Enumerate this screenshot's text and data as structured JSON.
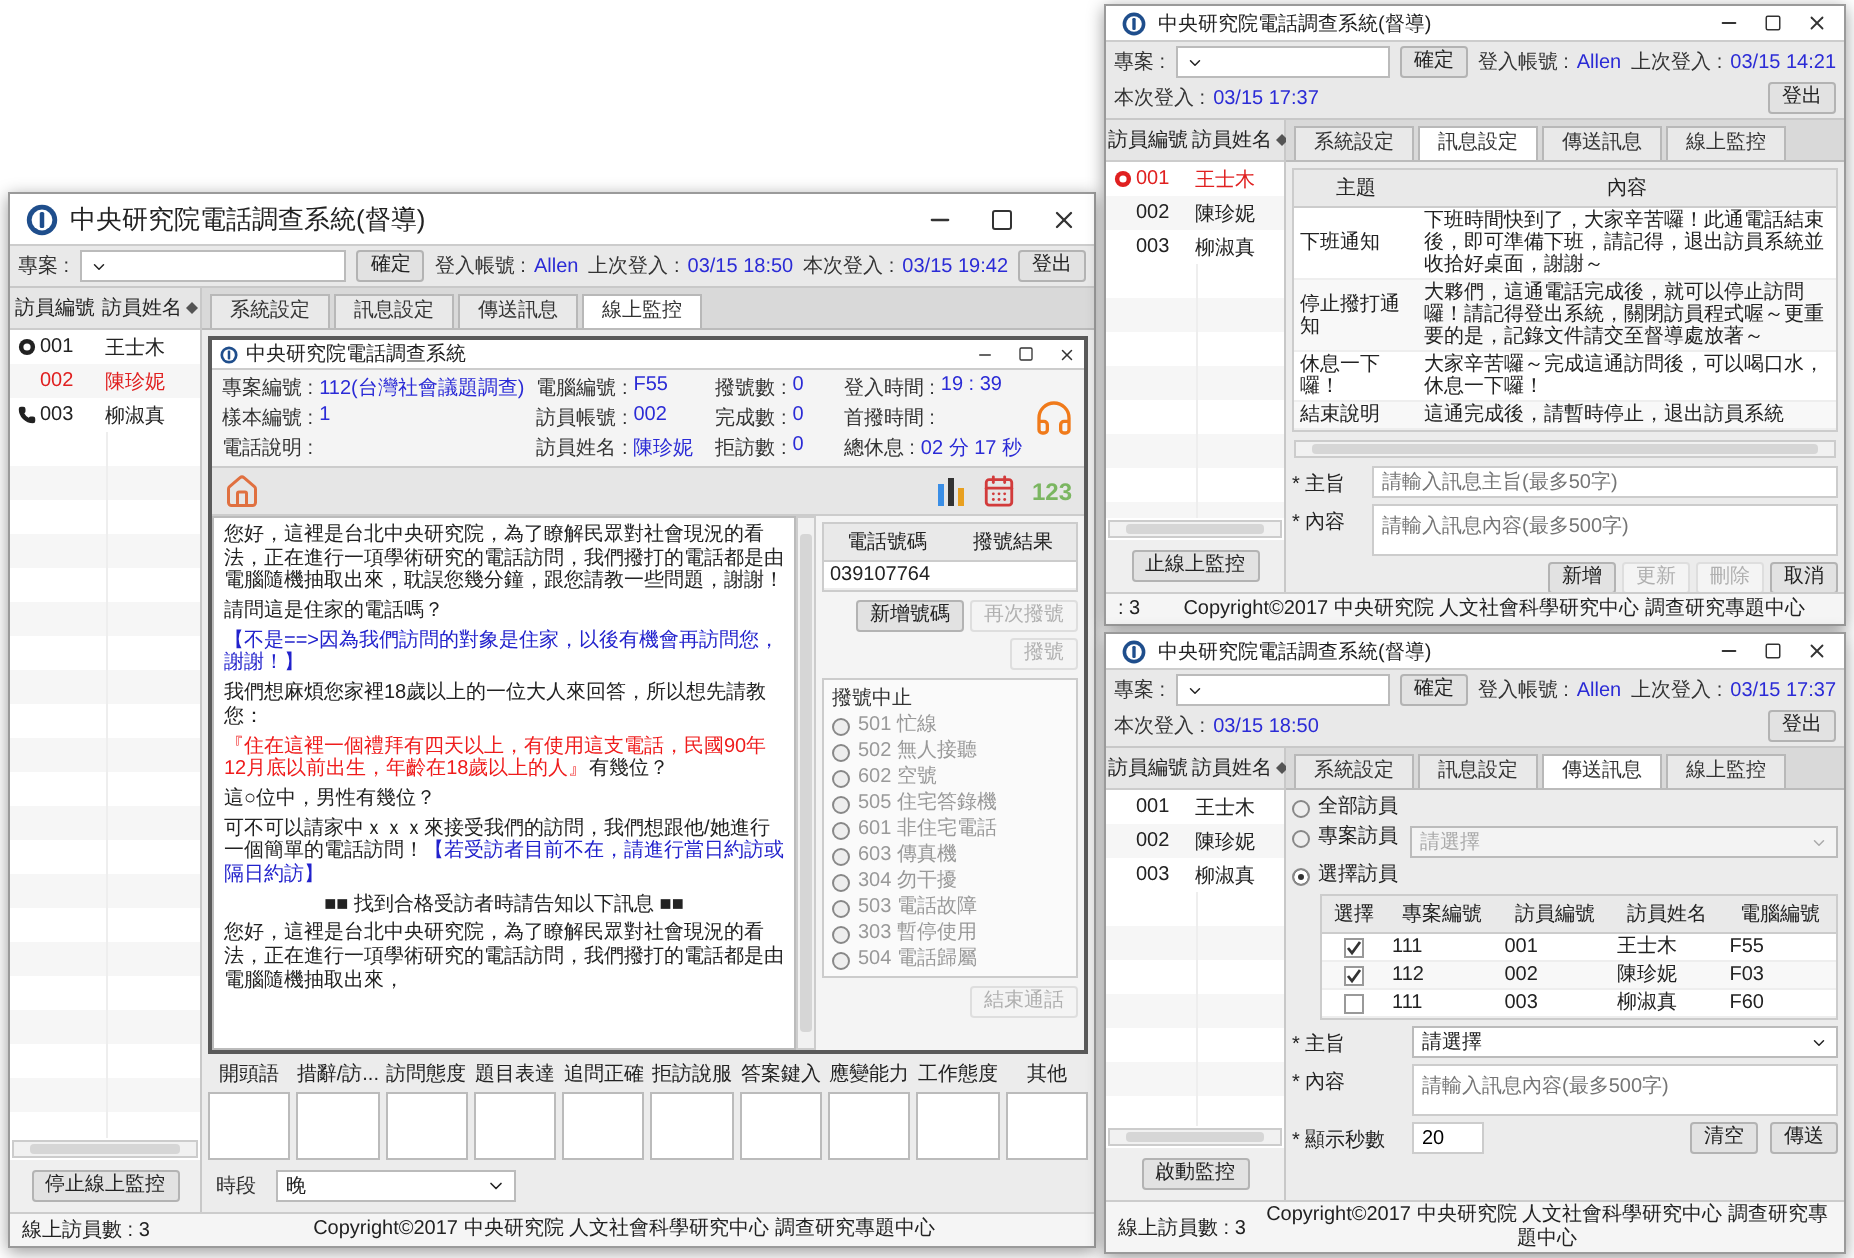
{
  "windows": [
    {
      "kind": "monitor",
      "title": "中央研究院電話調查系統(督導)",
      "toolbar": {
        "project_label": "專案 :",
        "confirm": "確定",
        "account_label": "登入帳號 :",
        "account": "Allen",
        "last_login_label": "上次登入 :",
        "last_login": "03/15 18:50",
        "this_login_label": "本次登入 :",
        "this_login": "03/15 19:42",
        "logout": "登出"
      },
      "sidebar": {
        "columns": [
          "訪員編號",
          "訪員姓名"
        ],
        "rows": [
          {
            "id": "001",
            "name": "王士木",
            "kind": "monitor",
            "highlighted": false
          },
          {
            "id": "002",
            "name": "陳珍妮",
            "highlighted": true
          },
          {
            "id": "003",
            "name": "柳淑真",
            "kind": "phone",
            "highlighted": false
          }
        ],
        "button": "停止線上監控"
      },
      "tabs": [
        {
          "label": "系統設定",
          "selected": false
        },
        {
          "label": "訊息設定",
          "selected": false
        },
        {
          "label": "傳送訊息",
          "selected": false
        },
        {
          "label": "線上監控",
          "selected": true
        }
      ],
      "monitor": {
        "title": "中央研究院電話調查系統",
        "info": [
          {
            "label": "專案編號 :",
            "value": "112(台灣社會議題調查)"
          },
          {
            "label": "電腦編號 :",
            "value": "F55"
          },
          {
            "label": "撥號數 :",
            "value": "0"
          },
          {
            "label": "登入時間 :",
            "value": "19 : 39"
          },
          {
            "label": "樣本編號 :",
            "value": "1"
          },
          {
            "label": "訪員帳號 :",
            "value": "002"
          },
          {
            "label": "完成數 :",
            "value": "0"
          },
          {
            "label": "首撥時間 :"
          },
          {
            "label": "電話說明 :"
          },
          {
            "label": "訪員姓名 :",
            "value": "陳珍妮"
          },
          {
            "label": "拒訪數 :",
            "value": "0"
          },
          {
            "label": "總休息 :",
            "value": "02 分 17 秒"
          }
        ],
        "numbers_icon": "123",
        "script": [
          {
            "kind": "text",
            "segments": [
              {
                "kind": "plain",
                "text": "您好，這裡是台北中央研究院，為了瞭解民眾對社會現況的看法，正在進行一項學術研究的電話訪問，我們撥打的電話都是由電腦隨機抽取出來，耽誤您幾分鐘，跟您請教一些問題，謝謝！"
              }
            ]
          },
          {
            "kind": "text",
            "segments": [
              {
                "kind": "plain",
                "text": "請問這是住家的電話嗎？"
              }
            ]
          },
          {
            "kind": "text",
            "segments": [
              {
                "kind": "note",
                "text": "【不是==>因為我們訪問的對象是住家，以後有機會再訪問您，謝謝！】"
              }
            ]
          },
          {
            "kind": "text",
            "segments": [
              {
                "kind": "plain",
                "text": "我們想麻煩您家裡18歲以上的一位大人來回答，所以想先請教您："
              }
            ]
          },
          {
            "kind": "text",
            "segments": [
              {
                "kind": "emphasis",
                "text": "『住在這裡一個禮拜有四天以上，有使用這支電話，民國90年12月底以前出生，年齡在18歲以上的人』"
              },
              {
                "kind": "plain",
                "text": "有幾位？"
              }
            ]
          },
          {
            "kind": "text",
            "segments": [
              {
                "kind": "plain",
                "text": "這○位中，男性有幾位？"
              }
            ]
          },
          {
            "kind": "text",
            "segments": [
              {
                "kind": "plain",
                "text": "可不可以請家中ｘｘｘ來接受我們的訪問，我們想跟他/她進行一個簡單的電話訪問！"
              },
              {
                "kind": "note",
                "text": "【若受訪者目前不在，請進行當日約訪或隔日約訪】"
              }
            ]
          },
          {
            "kind": "divider",
            "segments": [
              {
                "kind": "plain",
                "text": "■■ 找到合格受訪者時請告知以下訊息 ■■"
              }
            ]
          },
          {
            "kind": "text",
            "segments": [
              {
                "kind": "plain",
                "text": "您好，這裡是台北中央研究院，為了瞭解民眾對社會現況的看法，正在進行一項學術研究的電話訪問，我們撥打的電話都是由電腦隨機抽取出來，"
              }
            ]
          }
        ],
        "phones": {
          "columns": [
            "電話號碼",
            "撥號結果"
          ],
          "rows": [
            {
              "number": "039107764"
            }
          ]
        },
        "phone_buttons": [
          {
            "label": "新增號碼",
            "disabled": false
          },
          {
            "label": "再次撥號",
            "disabled": true
          },
          {
            "label": "撥號",
            "disabled": true
          }
        ],
        "hangup": {
          "title": "撥號中止",
          "options": [
            {
              "label": "501 忙線",
              "selected": false,
              "disabled": true
            },
            {
              "label": "502 無人接聽",
              "selected": false,
              "disabled": true
            },
            {
              "label": "602 空號",
              "selected": false,
              "disabled": true
            },
            {
              "label": "505 住宅答錄機",
              "selected": false,
              "disabled": true
            },
            {
              "label": "601 非住宅電話",
              "selected": false,
              "disabled": true
            },
            {
              "label": "603 傳真機",
              "selected": false,
              "disabled": true
            },
            {
              "label": "304 勿干擾",
              "selected": false,
              "disabled": true
            },
            {
              "label": "503 電話故障",
              "selected": false,
              "disabled": true
            },
            {
              "label": "303 暫停使用",
              "selected": false,
              "disabled": true
            },
            {
              "label": "504 電話歸屬",
              "selected": false,
              "disabled": true
            }
          ]
        },
        "end_call": {
          "label": "結束通話",
          "disabled": true
        },
        "ratings": [
          "開頭語",
          "措辭/訪...",
          "訪問態度",
          "題目表達",
          "追問正確",
          "拒訪說服",
          "答案鍵入",
          "應變能力",
          "工作態度",
          "其他"
        ],
        "period": {
          "label": "時段",
          "value": "晚"
        }
      },
      "status": {
        "count": "線上訪員數 :  3",
        "copyright": "Copyright©2017 中央研究院 人文社會科學研究中心 調查研究專題中心"
      }
    },
    {
      "kind": "messages",
      "title": "中央研究院電話調查系統(督導)",
      "toolbar": {
        "project_label": "專案 :",
        "confirm": "確定",
        "account_label": "登入帳號 :",
        "account": "Allen",
        "last_login_label": "上次登入 :",
        "last_login": "03/15 14:21",
        "this_login_label": "本次登入 :",
        "this_login": "03/15 17:37",
        "logout": "登出"
      },
      "sidebar": {
        "columns": [
          "訪員編號",
          "訪員姓名"
        ],
        "rows": [
          {
            "id": "001",
            "name": "王士木",
            "kind": "monitor",
            "highlighted": true
          },
          {
            "id": "002",
            "name": "陳珍妮",
            "highlighted": false
          },
          {
            "id": "003",
            "name": "柳淑真",
            "highlighted": false
          }
        ],
        "button": "止線上監控"
      },
      "tabs": [
        {
          "label": "系統設定",
          "selected": false
        },
        {
          "label": "訊息設定",
          "selected": true
        },
        {
          "label": "傳送訊息",
          "selected": false
        },
        {
          "label": "線上監控",
          "selected": false
        }
      ],
      "messages": {
        "columns": [
          "主題",
          "內容"
        ],
        "rows": [
          {
            "subject": "下班通知",
            "content": "下班時間快到了，大家辛苦囉！此通電話結束後，即可準備下班，請記得，退出訪員系統並收拾好桌面，謝謝～"
          },
          {
            "subject": "停止撥打通知",
            "content": "大夥們，這通電話完成後，就可以停止訪問囉！請記得登出系統，關閉訪員程式喔～更重要的是，記錄文件請交至督導處放著～"
          },
          {
            "subject": "休息一下囉！",
            "content": "大家辛苦囉～完成這通訪問後，可以喝口水，休息一下囉！"
          },
          {
            "subject": "結束說明",
            "content": "這通完成後，請暫時停止，退出訪員系統"
          }
        ],
        "subject": {
          "label": "* 主旨",
          "placeholder": "請輸入訊息主旨(最多50字)"
        },
        "content": {
          "label": "* 內容",
          "placeholder": "請輸入訊息內容(最多500字)"
        },
        "buttons": [
          {
            "label": "新增",
            "disabled": false
          },
          {
            "label": "更新",
            "disabled": true
          },
          {
            "label": "刪除",
            "disabled": true
          },
          {
            "label": "取消",
            "disabled": false
          }
        ]
      },
      "status": {
        "count": ": 3",
        "copyright": "Copyright©2017 中央研究院 人文社會科學研究中心 調查研究專題中心"
      }
    },
    {
      "kind": "send",
      "title": "中央研究院電話調查系統(督導)",
      "toolbar": {
        "project_label": "專案 :",
        "confirm": "確定",
        "account_label": "登入帳號 :",
        "account": "Allen",
        "last_login_label": "上次登入 :",
        "last_login": "03/15 17:37",
        "this_login_label": "本次登入 :",
        "this_login": "03/15 18:50",
        "logout": "登出"
      },
      "sidebar": {
        "columns": [
          "訪員編號",
          "訪員姓名"
        ],
        "rows": [
          {
            "id": "001",
            "name": "王士木",
            "highlighted": false
          },
          {
            "id": "002",
            "name": "陳珍妮",
            "highlighted": false
          },
          {
            "id": "003",
            "name": "柳淑真",
            "highlighted": false
          }
        ],
        "button": "啟動監控"
      },
      "tabs": [
        {
          "label": "系統設定",
          "selected": false
        },
        {
          "label": "訊息設定",
          "selected": false
        },
        {
          "label": "傳送訊息",
          "selected": true
        },
        {
          "label": "線上監控",
          "selected": false
        }
      ],
      "send": {
        "recipients": [
          {
            "label": "全部訪員",
            "selected": false
          },
          {
            "label": "專案訪員",
            "selected": false
          },
          {
            "label": "選擇訪員",
            "selected": true
          }
        ],
        "project_select": {
          "placeholder": "請選擇",
          "disabled": true
        },
        "columns": [
          "選擇",
          "專案編號",
          "訪員編號",
          "訪員姓名",
          "電腦編號"
        ],
        "rows": [
          {
            "checked": true,
            "project": "111",
            "id": "001",
            "name": "王士木",
            "computer": "F55"
          },
          {
            "checked": true,
            "project": "112",
            "id": "002",
            "name": "陳珍妮",
            "computer": "F03"
          },
          {
            "checked": false,
            "project": "111",
            "id": "003",
            "name": "柳淑真",
            "computer": "F60"
          }
        ],
        "subject": {
          "label": "* 主旨",
          "value": "請選擇"
        },
        "content": {
          "label": "* 內容",
          "placeholder": "請輸入訊息內容(最多500字)"
        },
        "seconds": {
          "label": "* 顯示秒數",
          "value": "20"
        },
        "buttons": [
          {
            "label": "清空",
            "disabled": false
          },
          {
            "label": "傳送",
            "disabled": false
          }
        ]
      },
      "status": {
        "count": "線上訪員數 :  3",
        "copyright": "Copyright©2017 中央研究院 人文社會科學研究中心 調查研究專題中心"
      }
    }
  ]
}
